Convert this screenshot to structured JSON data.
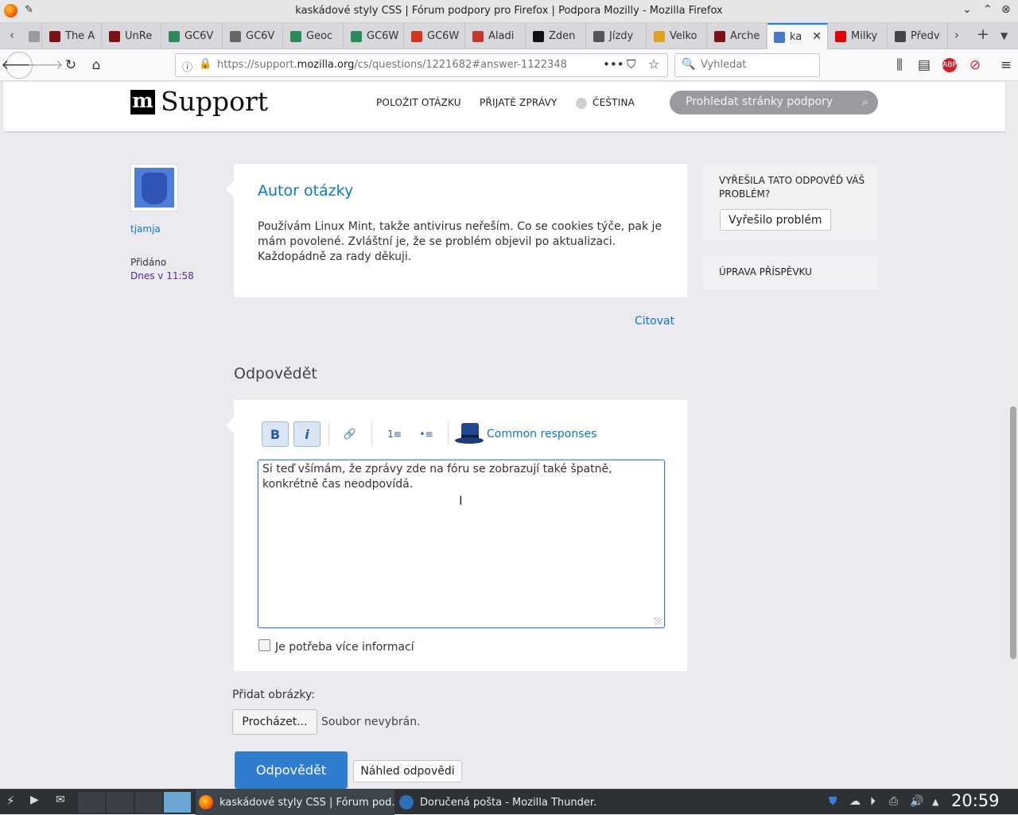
{
  "window": {
    "title": "kaskádové styly CSS | Fórum podpory pro Firefox | Podpora Mozilly - Mozilla Firefox"
  },
  "tabs": [
    {
      "label": "",
      "color": "#9a9a9a"
    },
    {
      "label": "The A",
      "color": "#7a1414"
    },
    {
      "label": "UnRe",
      "color": "#7a1414"
    },
    {
      "label": "GC6V",
      "color": "#2e8b57"
    },
    {
      "label": "GC6V",
      "color": "#666666"
    },
    {
      "label": "Geoc",
      "color": "#2e8b57"
    },
    {
      "label": "GC6W",
      "color": "#2e8b57"
    },
    {
      "label": "GC6W",
      "color": "#d2361e"
    },
    {
      "label": "Aladi",
      "color": "#c0392b"
    },
    {
      "label": "Zden",
      "color": "#111111"
    },
    {
      "label": "Jízdy",
      "color": "#555555"
    },
    {
      "label": "Velko",
      "color": "#e0a020"
    },
    {
      "label": "Arche",
      "color": "#7a1414"
    },
    {
      "label": "ka",
      "color": "#4a78c8"
    },
    {
      "label": "Milky",
      "color": "#e00000"
    },
    {
      "label": "Předv",
      "color": "#444444"
    }
  ],
  "navbar": {
    "url_prefix": "https://support.",
    "url_domain": "mozilla.org",
    "url_path": "/cs/questions/1221682#answer-1122348",
    "search_placeholder": "Vyhledat"
  },
  "site": {
    "logo_letter": "m",
    "logo_text": "Support",
    "nav": [
      "POLOŽIT OTÁZKU",
      "PŘIJATÉ ZPRÁVY",
      "ČEŠTINA"
    ],
    "search_placeholder": "Prohledat stránky podpory"
  },
  "post": {
    "username": "tjamja",
    "added_label": "Přidáno",
    "added_value": "Dnes v 11:58",
    "heading": "Autor otázky",
    "body": "Používám Linux Mint, takže antivirus neřeším. Co se cookies týče, pak je mám povolené. Zvláštní je, že se problém objevil po aktualizaci. Každopádně za rady děkuji.",
    "quote": "Citovat"
  },
  "sidebar": {
    "question": "VYŘEŠILA TATO ODPOVĚĎ VÁŠ PROBLÉM?",
    "solved_button": "Vyřešilo problém",
    "edit_label": "ÚPRAVA PŘÍSPĚVKU"
  },
  "reply": {
    "heading": "Odpovědět",
    "toolbar": {
      "bold": "B",
      "italic": "i",
      "link": "🔗",
      "ol": "1≡",
      "ul": "•≡",
      "common": "Common responses"
    },
    "editor_text": "Si teď všímám, že zprávy zde na fóru se zobrazují také špatně, konkrétně čas neodpovídá.",
    "need_info": "Je potřeba více informací",
    "add_images": "Přidat obrázky:",
    "browse": "Procházet...",
    "no_file": "Soubor nevybrán.",
    "submit": "Odpovědět",
    "preview": "Náhled odpovědi"
  },
  "taskbar": {
    "task1": "kaskádové styly CSS | Fórum pod...",
    "task2": "Doručená pošta - Mozilla Thunder...",
    "clock": "20:59"
  }
}
